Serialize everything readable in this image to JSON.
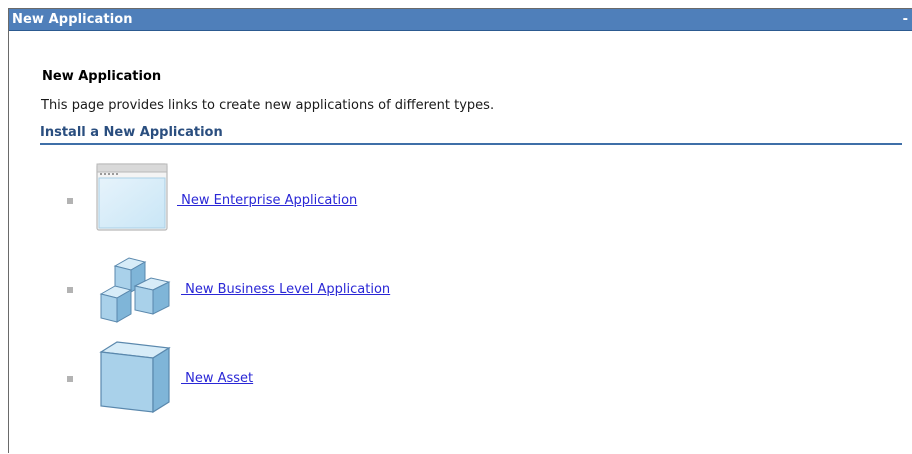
{
  "titlebar": {
    "title": "New Application",
    "minimize_label": "-"
  },
  "page": {
    "heading": "New Application",
    "description": "This page provides links to create new applications of different types."
  },
  "section": {
    "title": "Install a New Application"
  },
  "items": [
    {
      "label": " New Enterprise Application",
      "icon": "enterprise-application-window-icon"
    },
    {
      "label": " New Business Level Application",
      "icon": "business-level-application-cubes-icon"
    },
    {
      "label": " New Asset",
      "icon": "asset-cube-icon"
    }
  ],
  "colors": {
    "titlebar_bg": "#4f7fba",
    "section_title": "#2a4e7f",
    "section_rule": "#3f6fa8",
    "link": "#2a27d6"
  }
}
